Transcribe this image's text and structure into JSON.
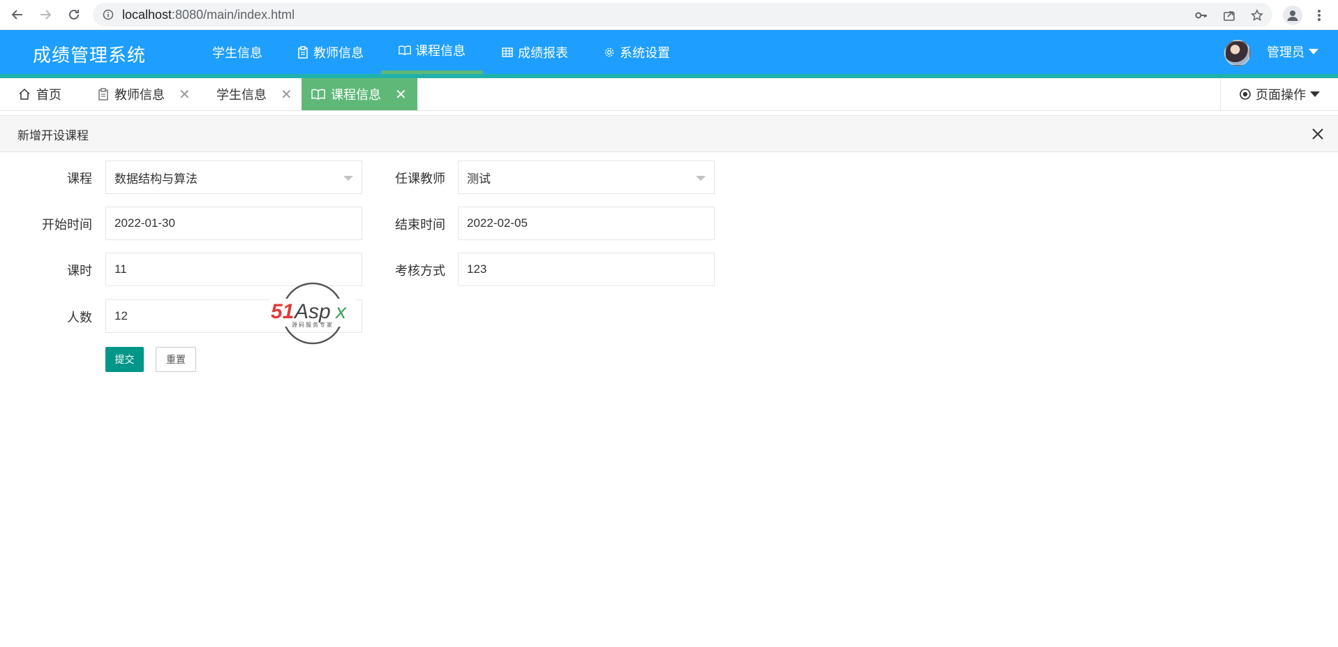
{
  "browser": {
    "url_host": "localhost",
    "url_rest": ":8080/main/index.html"
  },
  "header": {
    "logo": "成绩管理系统",
    "nav": [
      {
        "label": "学生信息",
        "icon": "none"
      },
      {
        "label": "教师信息",
        "icon": "clipboard-icon"
      },
      {
        "label": "课程信息",
        "icon": "book-icon",
        "active": true
      },
      {
        "label": "成绩报表",
        "icon": "table-icon"
      },
      {
        "label": "系统设置",
        "icon": "gear-icon"
      }
    ],
    "user": "管理员"
  },
  "tabs": [
    {
      "label": "首页",
      "icon": "home-icon",
      "closable": false
    },
    {
      "label": "教师信息",
      "icon": "clipboard-icon",
      "closable": true
    },
    {
      "label": "学生信息",
      "icon": "none",
      "closable": true
    },
    {
      "label": "课程信息",
      "icon": "book-icon",
      "closable": true,
      "active": true
    }
  ],
  "page_ops": "页面操作",
  "panel": {
    "title": "新增开设课程"
  },
  "form": {
    "course_label": "课程",
    "course_value": "数据结构与算法",
    "teacher_label": "任课教师",
    "teacher_value": "测试",
    "start_label": "开始时间",
    "start_value": "2022-01-30",
    "end_label": "结束时间",
    "end_value": "2022-02-05",
    "hours_label": "课时",
    "hours_value": "11",
    "exam_label": "考核方式",
    "exam_value": "123",
    "count_label": "人数",
    "count_value": "12",
    "submit_label": "提交",
    "reset_label": "重置"
  },
  "watermark": {
    "brand": "51Aspx",
    "tagline": "源码服务专家"
  },
  "colors": {
    "header_bg": "#1e9fff",
    "active_tab": "#5fb878",
    "submit_btn": "#009688"
  }
}
